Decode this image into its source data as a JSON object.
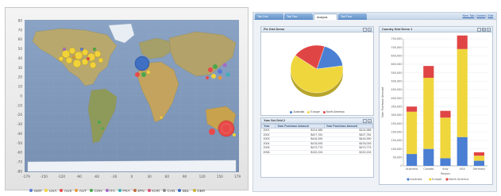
{
  "map": {
    "y_ticks": [
      "80",
      "70",
      "60",
      "50",
      "40",
      "30",
      "20",
      "10",
      "0",
      "-10",
      "-20",
      "-30",
      "-40",
      "-50",
      "-60",
      "-70",
      "-80"
    ],
    "x_ticks": [
      "-179",
      "-150",
      "-120",
      "-90",
      "-60",
      "-30",
      "0",
      "30",
      "60",
      "90",
      "120",
      "150",
      "179"
    ],
    "legend": [
      {
        "label": "GER",
        "color": "#5b7bd5"
      },
      {
        "label": "USA",
        "color": "#f2d23a"
      },
      {
        "label": "AUS",
        "color": "#e84a4a"
      },
      {
        "label": "AUT",
        "color": "#e39a3b"
      },
      {
        "label": "CHN",
        "color": "#4aa84a"
      },
      {
        "label": "ITA",
        "color": "#a56bc8"
      },
      {
        "label": "FRA",
        "color": "#3ab0b8"
      },
      {
        "label": "JPN",
        "color": "#c06b3b"
      },
      {
        "label": "KOR",
        "color": "#d8567b"
      },
      {
        "label": "CAN",
        "color": "#8a8a8a"
      },
      {
        "label": "BEL",
        "color": "#3b6bc0"
      },
      {
        "label": "GBR",
        "color": "#c8b23a"
      }
    ]
  },
  "dashboard": {
    "tabs": [
      {
        "label": "Tab One",
        "active": false
      },
      {
        "label": "Tab Two",
        "active": false
      },
      {
        "label": "Analysis",
        "active": true
      },
      {
        "label": "Tab Four",
        "active": false
      }
    ],
    "links": [
      "New Tab",
      "Delete",
      "Edit"
    ],
    "pie": {
      "title": "Pie Grid Demo",
      "slices": [
        {
          "name": "Australia",
          "value": 18,
          "color": "#4a7fd4"
        },
        {
          "name": "Europe",
          "value": 62,
          "color": "#efd63c"
        },
        {
          "name": "North America",
          "value": 20,
          "color": "#e04545"
        }
      ]
    },
    "table": {
      "title": "Year Set Grid 2",
      "headers": [
        "Year",
        "Sum Purchase Amount",
        "Year Purchase Amount"
      ],
      "rows": [
        [
          "2001",
          "$124,985",
          "$124,985"
        ],
        [
          "2002",
          "$427,781",
          "$427,781"
        ],
        [
          "2003",
          "$416,390",
          "$416,390"
        ],
        [
          "2004",
          "$478,093",
          "$478,093"
        ],
        [
          "2005",
          "$473,773",
          "$473,773"
        ],
        [
          "2006",
          "$132,224",
          "$132,224"
        ]
      ]
    }
  },
  "chart_data": {
    "type": "bar",
    "title": "Country Grid Demo 1",
    "categories": [
      "Australia",
      "Canada",
      "Italy",
      "USA",
      "Germany"
    ],
    "series": [
      {
        "name": "Australia",
        "color": "#4a7fd4",
        "values": [
          70000,
          100000,
          45000,
          170000,
          30000
        ]
      },
      {
        "name": "Europe",
        "color": "#efd63c",
        "values": [
          250000,
          420000,
          240000,
          520000,
          30000
        ]
      },
      {
        "name": "North America",
        "color": "#e04545",
        "values": [
          30000,
          70000,
          40000,
          80000,
          20000
        ]
      }
    ],
    "xlabel": "Region",
    "ylabel": "Sum Purchase Amount",
    "ylim": [
      0,
      750000
    ],
    "y_ticks": [
      "750,000",
      "700,000",
      "650,000",
      "600,000",
      "550,000",
      "500,000",
      "450,000",
      "400,000",
      "350,000",
      "300,000",
      "250,000",
      "200,000",
      "150,000",
      "100,000",
      "50,000",
      "0"
    ],
    "legend": "bottom"
  }
}
